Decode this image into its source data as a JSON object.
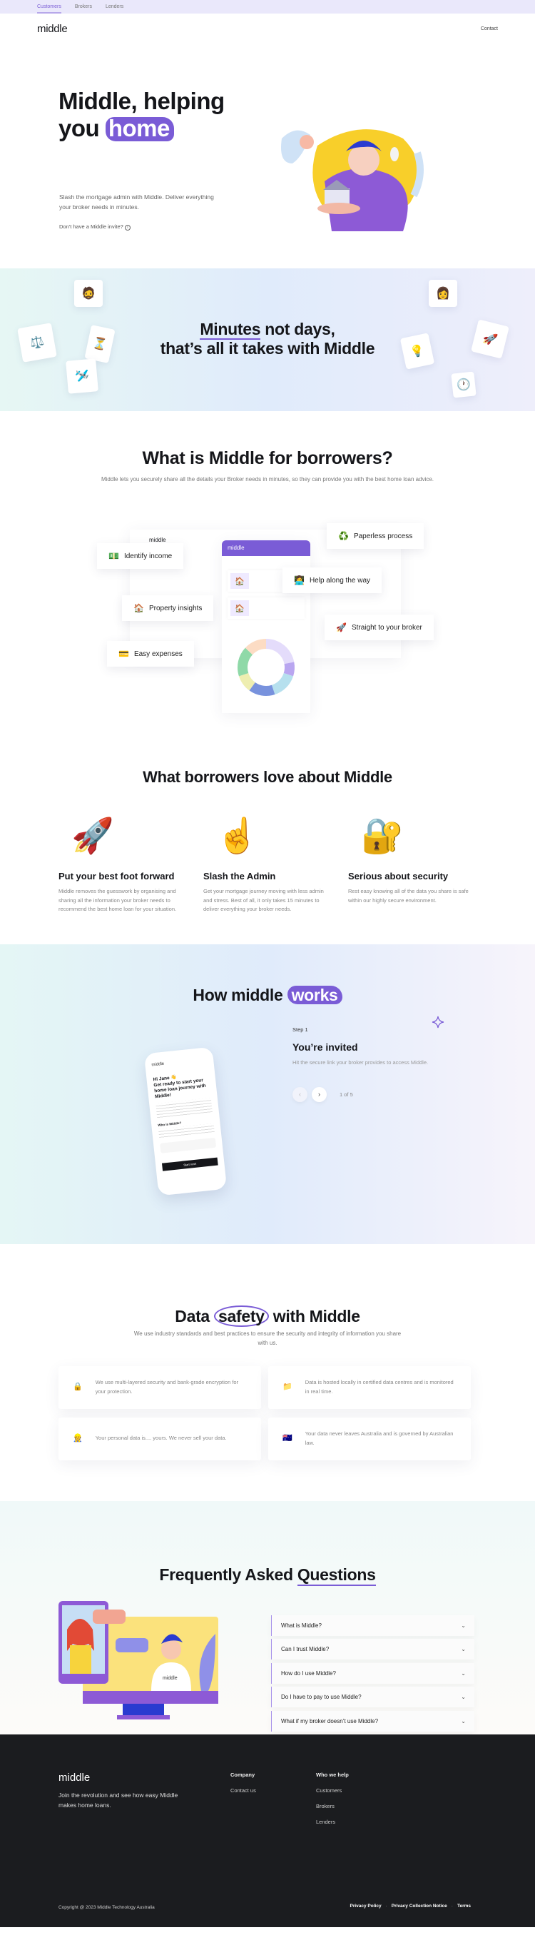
{
  "topnav": {
    "items": [
      {
        "label": "Customers",
        "active": true
      },
      {
        "label": "Brokers"
      },
      {
        "label": "Lenders"
      }
    ]
  },
  "header": {
    "logo": "middle",
    "contact": "Contact"
  },
  "hero": {
    "title_line1": "Middle, helping",
    "title_you": "you",
    "title_highlight": "home",
    "subtitle": "Slash the mortgage admin with Middle. Deliver everything your broker needs in minutes.",
    "invite": "Don't have a Middle invite?",
    "invite_icon": "info-icon"
  },
  "band": {
    "highlight": "Minutes",
    "line1_rest": " not days,",
    "line2": "that’s all it takes with Middle"
  },
  "what": {
    "title": "What is Middle for borrowers?",
    "description": "Middle lets you securely share all the details your Broker needs in minutes, so they can provide you with the best home loan advice.",
    "mock_logo": "middle",
    "app_logo": "middle",
    "features": [
      {
        "label": "Identify income",
        "icon": "💵"
      },
      {
        "label": "Property insights",
        "icon": "🏠"
      },
      {
        "label": "Easy expenses",
        "icon": "💳"
      },
      {
        "label": "Paperless process",
        "icon": "♻️"
      },
      {
        "label": "Help along the way",
        "icon": "👩‍💻"
      },
      {
        "label": "Straight to your broker",
        "icon": "🚀"
      }
    ],
    "donut_colors": [
      "#e4dcfb",
      "#b9a6f0",
      "#b6e0ee",
      "#7892dd",
      "#eeeeb0",
      "#8fd9a8",
      "#fcdcc4"
    ]
  },
  "love": {
    "title": "What borrowers love about Middle",
    "items": [
      {
        "title": "Put your best foot forward",
        "text": "Middle removes the guesswork by organising and sharing all the information your broker needs to recommend the best home loan for your situation.",
        "icon": "🚀"
      },
      {
        "title": "Slash the Admin",
        "text": "Get your mortgage journey moving with less admin and stress. Best of all, it only takes 15 minutes to deliver everything your broker needs.",
        "icon": "☝️"
      },
      {
        "title": "Serious about security",
        "text": "Rest easy knowing all of the data you share is safe within our highly secure environment.",
        "icon": "🔐"
      }
    ]
  },
  "how": {
    "title": "How middle",
    "highlight": "works",
    "step_label": "Step 1",
    "step_title": "You’re invited",
    "step_text": "Hit the secure link your broker provides to access Middle.",
    "counter": "1 of 5",
    "phone": {
      "logo": "middle",
      "greeting": "Hi Jane 👋",
      "headline": "Get ready to start your home loan journey with Middle!",
      "who": "Who is Middle?",
      "cta": "Start now!"
    }
  },
  "safety": {
    "title_pre": "Data",
    "title_circled": "safety",
    "title_post": "with Middle",
    "description": "We use industry standards and best practices to ensure the security and integrity of information you share with us.",
    "cards": [
      {
        "icon": "🔒",
        "text": "We use multi-layered security and bank-grade encryption for your protection."
      },
      {
        "icon": "📁",
        "text": "Data is hosted locally in certified data centres and is monitored in real time."
      },
      {
        "icon": "👷",
        "text": "Your personal data is.... yours. We never sell your data."
      },
      {
        "icon": "🇦🇺",
        "text": "Your data never leaves Australia and is governed by Australian law."
      }
    ]
  },
  "faq": {
    "title_pre": "Frequently Asked",
    "title_ul": "Questions",
    "questions": [
      "What is Middle?",
      "Can I trust Middle?",
      "How do I use Middle?",
      "Do I have to pay to use Middle?",
      "What if my broker doesn’t use Middle?"
    ],
    "shirt_text": "middle"
  },
  "footer": {
    "logo": "middle",
    "tagline": "Join the revolution and see how easy Middle makes home loans.",
    "company_heading": "Company",
    "company_links": [
      "Contact us"
    ],
    "who_heading": "Who we help",
    "who_links": [
      "Customers",
      "Brokers",
      "Lenders"
    ],
    "copyright": "Copyright @ 2023 Middle Technology Australia",
    "legal": [
      "Privacy Policy",
      "Privacy Collection Notice",
      "Terms"
    ]
  },
  "colors": {
    "accent": "#7a5cd6",
    "footer_bg": "#1b1c1f",
    "topbar_bg": "#eae8fb"
  }
}
